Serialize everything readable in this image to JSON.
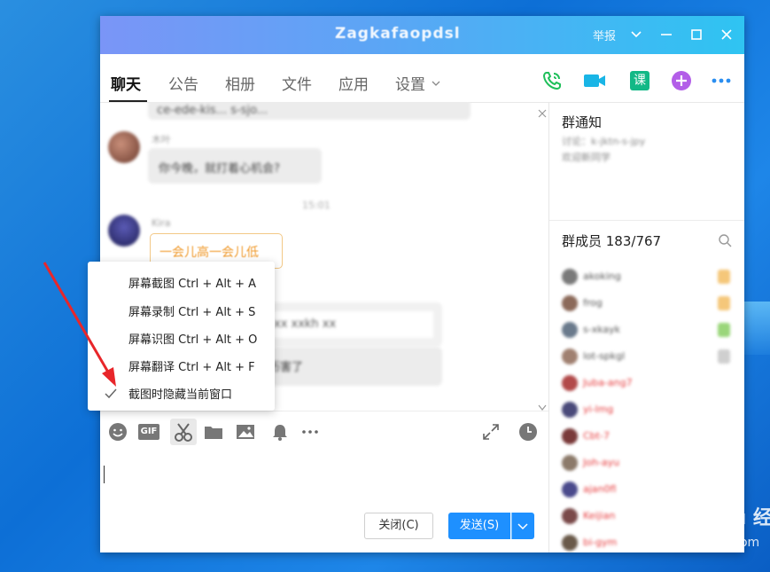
{
  "titlebar": {
    "title": "Zagkafaopdsl",
    "report": "举报"
  },
  "tabs": [
    {
      "label": "聊天"
    },
    {
      "label": "公告"
    },
    {
      "label": "相册"
    },
    {
      "label": "文件"
    },
    {
      "label": "应用"
    },
    {
      "label": "设置"
    }
  ],
  "tab_icon_ke": "课",
  "chat": {
    "msg_top": "ce-ede-kis...  s-sjo...",
    "msg1_name": "木叶",
    "msg1_text": "你今晚，就打着心机会?",
    "time_label": "15:01",
    "msg2_name": "Kira",
    "msg2_text": "一会儿高一会儿低",
    "msg3_text": "xx xxkh xx",
    "msg4_text": "历害了"
  },
  "menu": {
    "items": [
      {
        "label": "屏幕截图 Ctrl + Alt + A"
      },
      {
        "label": "屏幕录制 Ctrl + Alt + S"
      },
      {
        "label": "屏幕识图 Ctrl + Alt + O"
      },
      {
        "label": "屏幕翻译 Ctrl + Alt + F"
      },
      {
        "label": "截图时隐藏当前窗口",
        "checked": true
      }
    ]
  },
  "buttons": {
    "close": "关闭(C)",
    "send": "发送(S)"
  },
  "right": {
    "notice_title": "群通知",
    "notice_body_1": "讨论：k-jktn-s-jpy",
    "notice_body_2": "欢迎新同学",
    "members_title": "群成员 183/767",
    "members": [
      {
        "name": "akoking",
        "color": "#555"
      },
      {
        "name": "frog",
        "color": "#555"
      },
      {
        "name": "s-xkayk",
        "color": "#555"
      },
      {
        "name": "lot-spkgl",
        "color": "#555"
      },
      {
        "name": "Juba-ang7",
        "color": "#e6393b"
      },
      {
        "name": "yi-lmg",
        "color": "#e6393b"
      },
      {
        "name": "Cbt-7",
        "color": "#e6393b"
      },
      {
        "name": "Joh-ayu",
        "color": "#e6393b"
      },
      {
        "name": "ajan0fl",
        "color": "#e6393b"
      },
      {
        "name": "Keijian",
        "color": "#e6393b"
      },
      {
        "name": "bi-gym",
        "color": "#e6393b"
      }
    ]
  },
  "watermark": {
    "brand": "Bai du 经验",
    "url": "jingyan.baidu.com"
  }
}
